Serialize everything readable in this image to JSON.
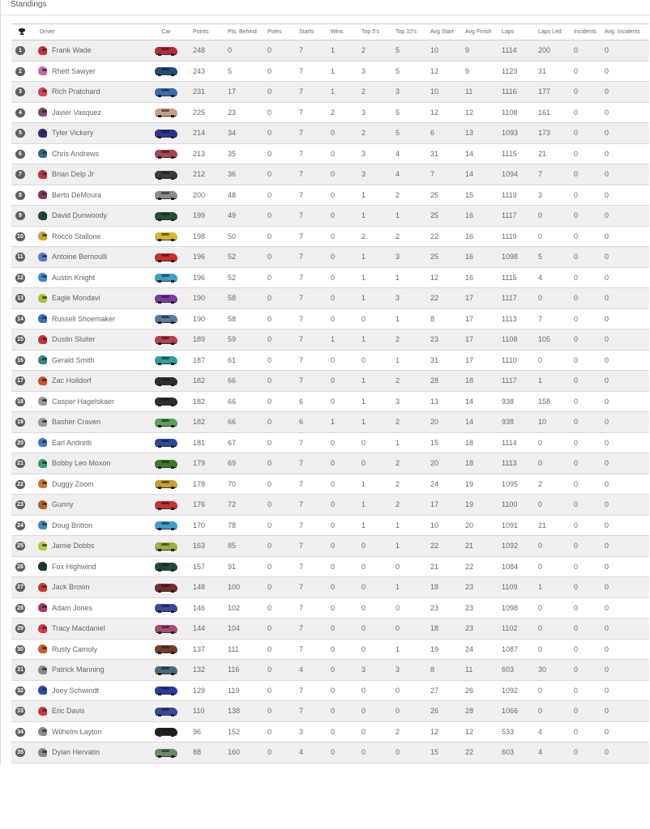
{
  "panel": {
    "title": "Standings"
  },
  "columns": {
    "position_icon": "trophy-icon",
    "driver": "Driver",
    "car": "Car",
    "points": "Points",
    "pts_behind": "Pts. Behind",
    "poles": "Poles",
    "starts": "Starts",
    "wins": "Wins",
    "top5": "Top 5's",
    "top10": "Top 10's",
    "avg_start": "Avg Start",
    "avg_finish": "Avg Finish",
    "laps": "Laps",
    "laps_led": "Laps Led",
    "incidents": "Incidents",
    "avg_incidents": "Avg. Incidents"
  },
  "rows": [
    {
      "pos": "1",
      "driver": "Frank Wade",
      "helmet": "#c8323c",
      "car": "#b52a35",
      "points": "248",
      "behind": "0",
      "poles": "0",
      "starts": "7",
      "wins": "1",
      "top5": "2",
      "top10": "5",
      "avg_start": "10",
      "avg_finish": "9",
      "laps": "1114",
      "laps_led": "200",
      "incidents": "0",
      "avg_incidents": "0"
    },
    {
      "pos": "2",
      "driver": "Rhett Sawyer",
      "helmet": "#c46aa8",
      "car": "#1f4f78",
      "points": "243",
      "behind": "5",
      "poles": "0",
      "starts": "7",
      "wins": "1",
      "top5": "3",
      "top10": "5",
      "avg_start": "12",
      "avg_finish": "9",
      "laps": "1123",
      "laps_led": "31",
      "incidents": "0",
      "avg_incidents": "0"
    },
    {
      "pos": "3",
      "driver": "Rich Pratchard",
      "helmet": "#d2445a",
      "car": "#3a6fb0",
      "points": "231",
      "behind": "17",
      "poles": "0",
      "starts": "7",
      "wins": "1",
      "top5": "2",
      "top10": "3",
      "avg_start": "10",
      "avg_finish": "11",
      "laps": "1116",
      "laps_led": "177",
      "incidents": "0",
      "avg_incidents": "0"
    },
    {
      "pos": "4",
      "driver": "Javier Vasquez",
      "helmet": "#7a4a70",
      "car": "#c9a08a",
      "points": "225",
      "behind": "23",
      "poles": "0",
      "starts": "7",
      "wins": "2",
      "top5": "3",
      "top10": "5",
      "avg_start": "12",
      "avg_finish": "12",
      "laps": "1108",
      "laps_led": "161",
      "incidents": "0",
      "avg_incidents": "0"
    },
    {
      "pos": "5",
      "driver": "Tyler Vickery",
      "helmet": "#2a2f7a",
      "car": "#2b3590",
      "points": "214",
      "behind": "34",
      "poles": "0",
      "starts": "7",
      "wins": "0",
      "top5": "2",
      "top10": "5",
      "avg_start": "6",
      "avg_finish": "13",
      "laps": "1093",
      "laps_led": "173",
      "incidents": "0",
      "avg_incidents": "0"
    },
    {
      "pos": "6",
      "driver": "Chris Andrews",
      "helmet": "#2f6d7a",
      "car": "#a84550",
      "points": "213",
      "behind": "35",
      "poles": "0",
      "starts": "7",
      "wins": "0",
      "top5": "3",
      "top10": "4",
      "avg_start": "31",
      "avg_finish": "14",
      "laps": "1115",
      "laps_led": "21",
      "incidents": "0",
      "avg_incidents": "0"
    },
    {
      "pos": "7",
      "driver": "Brian Delp Jr",
      "helmet": "#c0303a",
      "car": "#3a3a3a",
      "points": "212",
      "behind": "36",
      "poles": "0",
      "starts": "7",
      "wins": "0",
      "top5": "3",
      "top10": "4",
      "avg_start": "7",
      "avg_finish": "14",
      "laps": "1094",
      "laps_led": "7",
      "incidents": "0",
      "avg_incidents": "0"
    },
    {
      "pos": "8",
      "driver": "Berto DeMoura",
      "helmet": "#8a3a45",
      "car": "#8a8a8a",
      "points": "200",
      "behind": "48",
      "poles": "0",
      "starts": "7",
      "wins": "0",
      "top5": "1",
      "top10": "2",
      "avg_start": "25",
      "avg_finish": "15",
      "laps": "1119",
      "laps_led": "3",
      "incidents": "0",
      "avg_incidents": "0"
    },
    {
      "pos": "9",
      "driver": "David Dunwoody",
      "helmet": "#1f4a30",
      "car": "#27503a",
      "points": "199",
      "behind": "49",
      "poles": "0",
      "starts": "7",
      "wins": "0",
      "top5": "1",
      "top10": "1",
      "avg_start": "25",
      "avg_finish": "16",
      "laps": "1117",
      "laps_led": "0",
      "incidents": "0",
      "avg_incidents": "0"
    },
    {
      "pos": "10",
      "driver": "Rocco Stallone",
      "helmet": "#c4a628",
      "car": "#d6b82a",
      "points": "198",
      "behind": "50",
      "poles": "0",
      "starts": "7",
      "wins": "0",
      "top5": "2",
      "top10": "2",
      "avg_start": "22",
      "avg_finish": "16",
      "laps": "1119",
      "laps_led": "0",
      "incidents": "0",
      "avg_incidents": "0"
    },
    {
      "pos": "11",
      "driver": "Antoine Bernoulli",
      "helmet": "#5a7ac8",
      "car": "#d42a2a",
      "points": "196",
      "behind": "52",
      "poles": "0",
      "starts": "7",
      "wins": "0",
      "top5": "1",
      "top10": "3",
      "avg_start": "25",
      "avg_finish": "16",
      "laps": "1098",
      "laps_led": "5",
      "incidents": "0",
      "avg_incidents": "0"
    },
    {
      "pos": "12",
      "driver": "Austin Knight",
      "helmet": "#3a8ac8",
      "car": "#3aa0c8",
      "points": "196",
      "behind": "52",
      "poles": "0",
      "starts": "7",
      "wins": "0",
      "top5": "1",
      "top10": "1",
      "avg_start": "12",
      "avg_finish": "16",
      "laps": "1115",
      "laps_led": "4",
      "incidents": "0",
      "avg_incidents": "0"
    },
    {
      "pos": "13",
      "driver": "Eagle Mondavi",
      "helmet": "#a8c03a",
      "car": "#7a3aa8",
      "points": "190",
      "behind": "58",
      "poles": "0",
      "starts": "7",
      "wins": "0",
      "top5": "1",
      "top10": "3",
      "avg_start": "22",
      "avg_finish": "17",
      "laps": "1117",
      "laps_led": "0",
      "incidents": "0",
      "avg_incidents": "0"
    },
    {
      "pos": "14",
      "driver": "Russell Shoemaker",
      "helmet": "#3a6ac0",
      "car": "#5a7aa0",
      "points": "190",
      "behind": "58",
      "poles": "0",
      "starts": "7",
      "wins": "0",
      "top5": "0",
      "top10": "1",
      "avg_start": "8",
      "avg_finish": "17",
      "laps": "1113",
      "laps_led": "7",
      "incidents": "0",
      "avg_incidents": "0"
    },
    {
      "pos": "15",
      "driver": "Dustin Sluiter",
      "helmet": "#c83038",
      "car": "#b8404a",
      "points": "189",
      "behind": "59",
      "poles": "0",
      "starts": "7",
      "wins": "1",
      "top5": "1",
      "top10": "2",
      "avg_start": "23",
      "avg_finish": "17",
      "laps": "1108",
      "laps_led": "105",
      "incidents": "0",
      "avg_incidents": "0"
    },
    {
      "pos": "16",
      "driver": "Gerald Smith",
      "helmet": "#2a8a8a",
      "car": "#2aa0a0",
      "points": "187",
      "behind": "61",
      "poles": "0",
      "starts": "7",
      "wins": "0",
      "top5": "0",
      "top10": "1",
      "avg_start": "31",
      "avg_finish": "17",
      "laps": "1110",
      "laps_led": "0",
      "incidents": "0",
      "avg_incidents": "0"
    },
    {
      "pos": "17",
      "driver": "Zac Holldorf",
      "helmet": "#c8582a",
      "car": "#2e2e2e",
      "points": "182",
      "behind": "66",
      "poles": "0",
      "starts": "7",
      "wins": "0",
      "top5": "1",
      "top10": "2",
      "avg_start": "28",
      "avg_finish": "18",
      "laps": "1117",
      "laps_led": "1",
      "incidents": "0",
      "avg_incidents": "0"
    },
    {
      "pos": "18",
      "driver": "Casper Hagelskaer",
      "helmet": "#9a9a9a",
      "car": "#2a2f2a",
      "points": "182",
      "behind": "66",
      "poles": "0",
      "starts": "6",
      "wins": "0",
      "top5": "1",
      "top10": "3",
      "avg_start": "13",
      "avg_finish": "14",
      "laps": "938",
      "laps_led": "158",
      "incidents": "0",
      "avg_incidents": "0"
    },
    {
      "pos": "19",
      "driver": "Basher Craven",
      "helmet": "#9a9a9a",
      "car": "#5aa05a",
      "points": "182",
      "behind": "66",
      "poles": "0",
      "starts": "6",
      "wins": "1",
      "top5": "1",
      "top10": "2",
      "avg_start": "20",
      "avg_finish": "14",
      "laps": "938",
      "laps_led": "10",
      "incidents": "0",
      "avg_incidents": "0"
    },
    {
      "pos": "20",
      "driver": "Earl Andretti",
      "helmet": "#3a7ac0",
      "car": "#2a4aa0",
      "points": "181",
      "behind": "67",
      "poles": "0",
      "starts": "7",
      "wins": "0",
      "top5": "0",
      "top10": "1",
      "avg_start": "15",
      "avg_finish": "18",
      "laps": "1114",
      "laps_led": "0",
      "incidents": "0",
      "avg_incidents": "0"
    },
    {
      "pos": "21",
      "driver": "Bobby Leo Moxon",
      "helmet": "#3a9a6a",
      "car": "#3a7a2a",
      "points": "179",
      "behind": "69",
      "poles": "0",
      "starts": "7",
      "wins": "0",
      "top5": "0",
      "top10": "2",
      "avg_start": "20",
      "avg_finish": "18",
      "laps": "1113",
      "laps_led": "0",
      "incidents": "0",
      "avg_incidents": "0"
    },
    {
      "pos": "22",
      "driver": "Duggy Zoom",
      "helmet": "#c8782a",
      "car": "#c8a02a",
      "points": "178",
      "behind": "70",
      "poles": "0",
      "starts": "7",
      "wins": "0",
      "top5": "1",
      "top10": "2",
      "avg_start": "24",
      "avg_finish": "19",
      "laps": "1095",
      "laps_led": "2",
      "incidents": "0",
      "avg_incidents": "0"
    },
    {
      "pos": "23",
      "driver": "Gunny",
      "helmet": "#b8602a",
      "car": "#c83030",
      "points": "176",
      "behind": "72",
      "poles": "0",
      "starts": "7",
      "wins": "0",
      "top5": "1",
      "top10": "2",
      "avg_start": "17",
      "avg_finish": "19",
      "laps": "1100",
      "laps_led": "0",
      "incidents": "0",
      "avg_incidents": "0"
    },
    {
      "pos": "24",
      "driver": "Doug Britton",
      "helmet": "#3a8ac0",
      "car": "#3aa0d0",
      "points": "170",
      "behind": "78",
      "poles": "0",
      "starts": "7",
      "wins": "0",
      "top5": "1",
      "top10": "1",
      "avg_start": "10",
      "avg_finish": "20",
      "laps": "1091",
      "laps_led": "21",
      "incidents": "0",
      "avg_incidents": "0"
    },
    {
      "pos": "25",
      "driver": "Jamie Dobbs",
      "helmet": "#b8c83a",
      "car": "#a0b03a",
      "points": "163",
      "behind": "85",
      "poles": "0",
      "starts": "7",
      "wins": "0",
      "top5": "0",
      "top10": "1",
      "avg_start": "22",
      "avg_finish": "21",
      "laps": "1092",
      "laps_led": "0",
      "incidents": "0",
      "avg_incidents": "0"
    },
    {
      "pos": "26",
      "driver": "Fox Highwind",
      "helmet": "#1f3a2a",
      "car": "#1f4a3a",
      "points": "157",
      "behind": "91",
      "poles": "0",
      "starts": "7",
      "wins": "0",
      "top5": "0",
      "top10": "0",
      "avg_start": "21",
      "avg_finish": "22",
      "laps": "1084",
      "laps_led": "0",
      "incidents": "0",
      "avg_incidents": "0"
    },
    {
      "pos": "27",
      "driver": "Jack Brown",
      "helmet": "#c83a2a",
      "car": "#7a2a2a",
      "points": "148",
      "behind": "100",
      "poles": "0",
      "starts": "7",
      "wins": "0",
      "top5": "0",
      "top10": "1",
      "avg_start": "18",
      "avg_finish": "23",
      "laps": "1109",
      "laps_led": "1",
      "incidents": "0",
      "avg_incidents": "0"
    },
    {
      "pos": "28",
      "driver": "Adam Jones",
      "helmet": "#a83a6a",
      "car": "#3a4aa0",
      "points": "146",
      "behind": "102",
      "poles": "0",
      "starts": "7",
      "wins": "0",
      "top5": "0",
      "top10": "0",
      "avg_start": "23",
      "avg_finish": "23",
      "laps": "1098",
      "laps_led": "0",
      "incidents": "0",
      "avg_incidents": "0"
    },
    {
      "pos": "29",
      "driver": "Tracy Macdaniel",
      "helmet": "#d03a4a",
      "car": "#a84a7a",
      "points": "144",
      "behind": "104",
      "poles": "0",
      "starts": "7",
      "wins": "0",
      "top5": "0",
      "top10": "0",
      "avg_start": "18",
      "avg_finish": "23",
      "laps": "1102",
      "laps_led": "0",
      "incidents": "0",
      "avg_incidents": "0"
    },
    {
      "pos": "30",
      "driver": "Rusty Camoly",
      "helmet": "#c8602a",
      "car": "#7a3a2a",
      "points": "137",
      "behind": "111",
      "poles": "0",
      "starts": "7",
      "wins": "0",
      "top5": "0",
      "top10": "1",
      "avg_start": "19",
      "avg_finish": "24",
      "laps": "1087",
      "laps_led": "0",
      "incidents": "0",
      "avg_incidents": "0"
    },
    {
      "pos": "31",
      "driver": "Patrick Manning",
      "helmet": "#8a8a8a",
      "car": "#4a6a7a",
      "points": "132",
      "behind": "116",
      "poles": "0",
      "starts": "4",
      "wins": "0",
      "top5": "3",
      "top10": "3",
      "avg_start": "8",
      "avg_finish": "11",
      "laps": "603",
      "laps_led": "30",
      "incidents": "0",
      "avg_incidents": "0"
    },
    {
      "pos": "32",
      "driver": "Joey Schwindt",
      "helmet": "#2a4ab0",
      "car": "#2a3aa8",
      "points": "129",
      "behind": "119",
      "poles": "0",
      "starts": "7",
      "wins": "0",
      "top5": "0",
      "top10": "0",
      "avg_start": "27",
      "avg_finish": "26",
      "laps": "1092",
      "laps_led": "0",
      "incidents": "0",
      "avg_incidents": "0"
    },
    {
      "pos": "33",
      "driver": "Eric Davis",
      "helmet": "#c83a4a",
      "car": "#3a4a9a",
      "points": "110",
      "behind": "138",
      "poles": "0",
      "starts": "7",
      "wins": "0",
      "top5": "0",
      "top10": "0",
      "avg_start": "26",
      "avg_finish": "28",
      "laps": "1066",
      "laps_led": "0",
      "incidents": "0",
      "avg_incidents": "0"
    },
    {
      "pos": "34",
      "driver": "Wilhelm Layton",
      "helmet": "#8a8a8a",
      "car": "#1f1f1f",
      "points": "96",
      "behind": "152",
      "poles": "0",
      "starts": "3",
      "wins": "0",
      "top5": "0",
      "top10": "2",
      "avg_start": "12",
      "avg_finish": "12",
      "laps": "533",
      "laps_led": "4",
      "incidents": "0",
      "avg_incidents": "0"
    },
    {
      "pos": "35",
      "driver": "Dylan Hervatin",
      "helmet": "#8a8a8a",
      "car": "#6a8a6a",
      "points": "88",
      "behind": "160",
      "poles": "0",
      "starts": "4",
      "wins": "0",
      "top5": "0",
      "top10": "0",
      "avg_start": "15",
      "avg_finish": "22",
      "laps": "603",
      "laps_led": "4",
      "incidents": "0",
      "avg_incidents": "0"
    }
  ]
}
